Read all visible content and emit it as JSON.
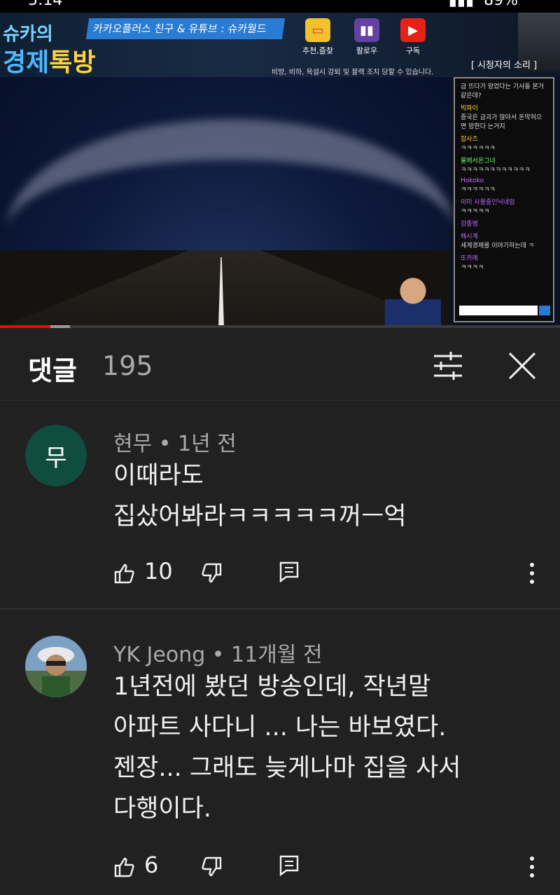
{
  "status_bar": {
    "time": "5:14",
    "battery": "89%"
  },
  "video": {
    "show_title_line1": "슈카의",
    "show_title_line2a": "경제",
    "show_title_line2b": "톡방",
    "promo_text": "카카오플러스 친구 & 유튜브 : 슈카월드",
    "channel_buttons": [
      "추천,즐찾",
      "팔로우",
      "구독"
    ],
    "warning_text": "비방, 비하, 욕설시 강퇴 및 블랙 조치 당할 수 있습니다.",
    "chat_title": "시청자의 소리",
    "chat_lines": [
      {
        "name": "",
        "msg": "금 뜨다가 망었다는 기사들 본거같은데?"
      },
      {
        "name": "빅파이",
        "msg": "중국은 금괴가 많아서 돈막혀으면 망한다 는거지"
      },
      {
        "name": "찹사즈",
        "msg": "ㅋㅋㅋㅋㅋㅋ"
      },
      {
        "name": "물에서온그녀",
        "msg": "ㅋㅋㅋㅋㅋㅋㅋㅋㅋㅋㅋㅋ"
      },
      {
        "name": "Hokoko",
        "msg": "ㅋㅋㅋㅋㅋㅋ"
      },
      {
        "name": "이미 사용중인닉네임",
        "msg": "ㅋㅋㅋㅋㅋ"
      },
      {
        "name": "강종명",
        "msg": ""
      },
      {
        "name": "해시계",
        "msg": "세계경제를 이야기하는데 ㅋ"
      },
      {
        "name": "또카래",
        "msg": "ㅋㅋㅋㅋ"
      }
    ],
    "progress": {
      "played_fraction": 0.09,
      "buffered_fraction": 0.125
    }
  },
  "comments_panel": {
    "title": "댓글",
    "count": "195",
    "comments": [
      {
        "avatar_letter": "무",
        "avatar_color": "#0f4d3f",
        "author": "현무",
        "time": "1년 전",
        "text": "이때라도\n집샀어봐라ㅋㅋㅋㅋㅋ꺼ㅡ억",
        "likes": "10"
      },
      {
        "avatar_letter": "",
        "avatar_color": "#5f7a5a",
        "author": "YK Jeong",
        "time": "11개월 전",
        "text": "1년전에 봤던 방송인데, 작년말\n아파트 사다니 ...  나는 바보였다.\n젠장... 그래도 늦게나마 집을 사서\n다행이다.",
        "likes": "6"
      }
    ]
  }
}
